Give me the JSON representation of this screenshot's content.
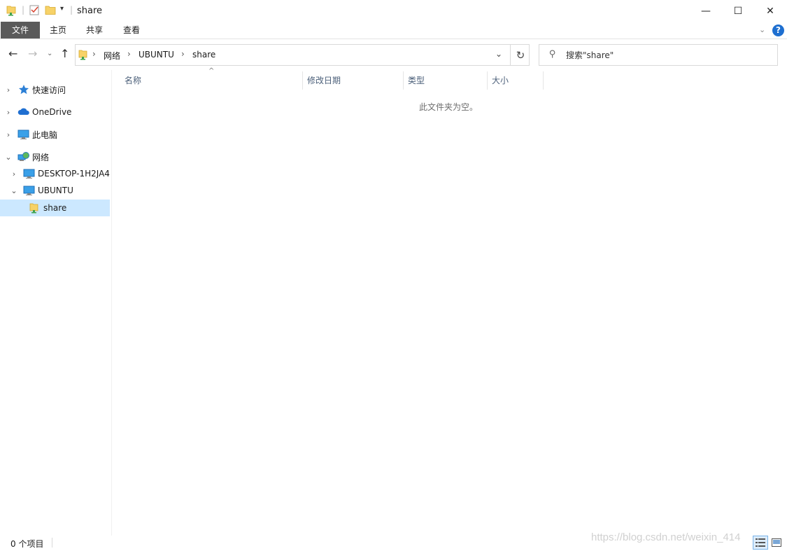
{
  "window": {
    "title": "share",
    "minimize_glyph": "—",
    "maximize_glyph": "☐",
    "close_glyph": "✕"
  },
  "ribbon": {
    "tabs": [
      {
        "label": "文件"
      },
      {
        "label": "主页"
      },
      {
        "label": "共享"
      },
      {
        "label": "查看"
      }
    ],
    "help_glyph": "?"
  },
  "address": {
    "breadcrumbs": [
      "网络",
      "UBUNTU",
      "share"
    ],
    "separator": "›"
  },
  "search": {
    "placeholder": "搜索\"share\""
  },
  "navpane": {
    "items": [
      {
        "label": "快速访问",
        "icon": "star-icon"
      },
      {
        "label": "OneDrive",
        "icon": "cloud-icon"
      },
      {
        "label": "此电脑",
        "icon": "monitor-icon"
      },
      {
        "label": "网络",
        "icon": "network-icon"
      },
      {
        "label": "DESKTOP-1H2JA4",
        "icon": "computer-icon"
      },
      {
        "label": "UBUNTU",
        "icon": "computer-icon"
      },
      {
        "label": "share",
        "icon": "share-folder-icon",
        "selected": true
      }
    ]
  },
  "content": {
    "columns": [
      "名称",
      "修改日期",
      "类型",
      "大小"
    ],
    "sort_column": "名称",
    "empty_message": "此文件夹为空。"
  },
  "status": {
    "item_count": "0 个项目"
  },
  "watermark": "https://blog.csdn.net/weixin_414"
}
